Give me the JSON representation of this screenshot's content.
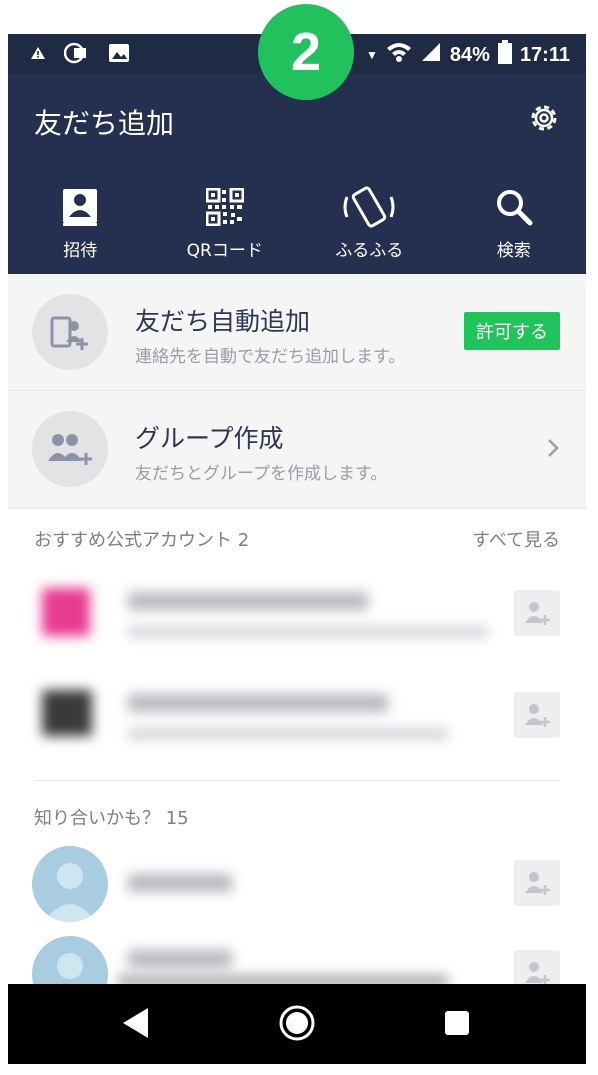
{
  "step_badge": "2",
  "status": {
    "battery": "84%",
    "time": "17:11",
    "icons": [
      "alert-icon",
      "cast-icon",
      "image-icon",
      "wifi-icon",
      "signal-icon",
      "battery-icon"
    ]
  },
  "header": {
    "title": "友だち追加"
  },
  "nav": [
    {
      "label": "招待",
      "icon": "contact-card-icon"
    },
    {
      "label": "QRコード",
      "icon": "qr-code-icon"
    },
    {
      "label": "ふるふる",
      "icon": "shake-phone-icon"
    },
    {
      "label": "検索",
      "icon": "search-icon"
    }
  ],
  "auto_add": {
    "title": "友だち自動追加",
    "subtitle": "連絡先を自動で友だち追加します。",
    "button": "許可する"
  },
  "group": {
    "title": "グループ作成",
    "subtitle": "友だちとグループを作成します。"
  },
  "official": {
    "heading": "おすすめ公式アカウント 2",
    "see_all": "すべて見る"
  },
  "people": {
    "heading": "知り合いかも？ 15"
  },
  "colors": {
    "header_bg": "#253051",
    "accent_green": "#1fc55a",
    "bottom_bar": "#000000"
  }
}
